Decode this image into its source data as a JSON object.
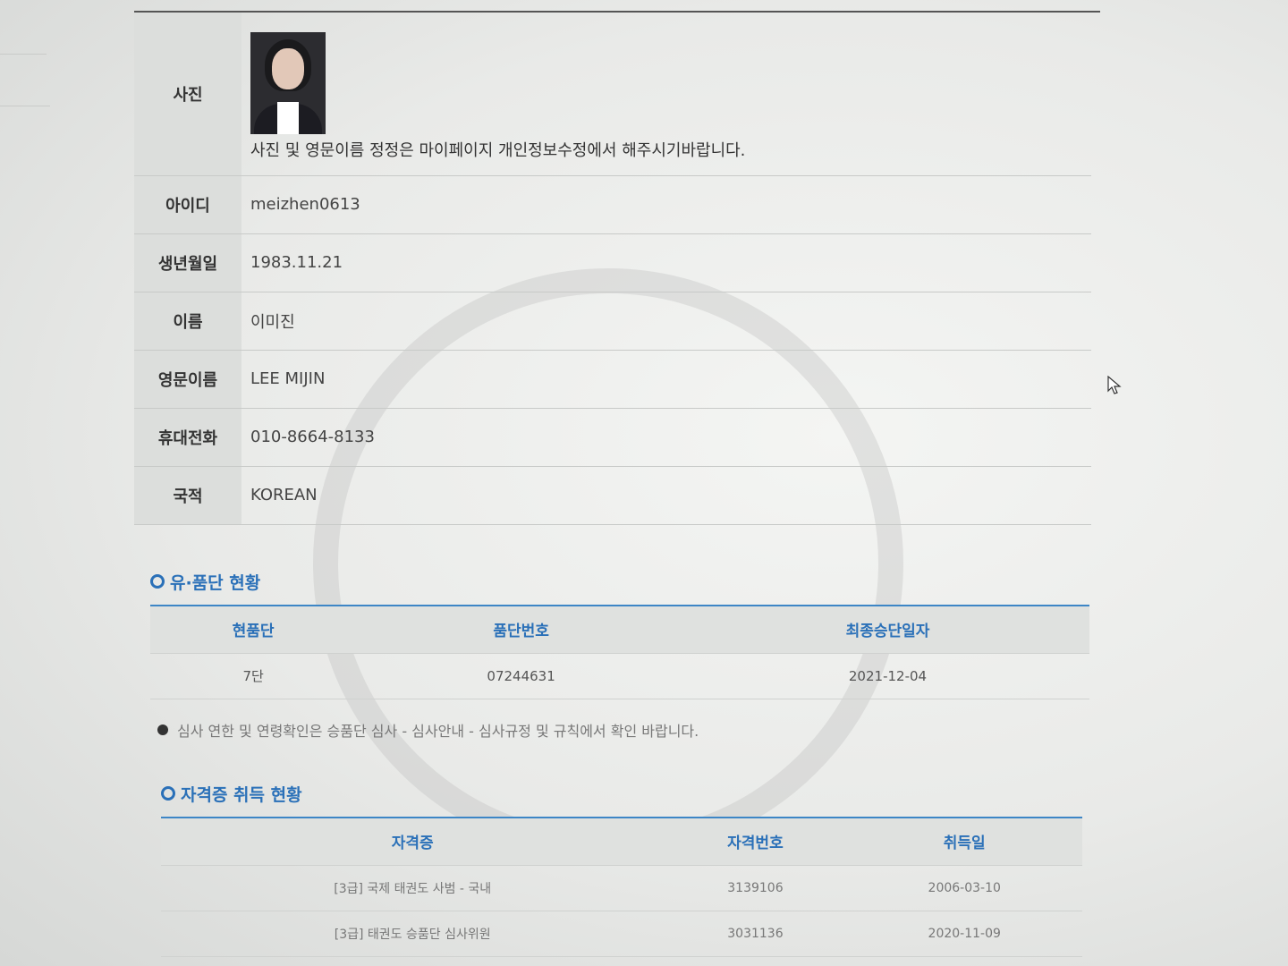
{
  "profile": {
    "photo_label": "사진",
    "photo_note": "사진 및 영문이름 정정은 마이페이지 개인정보수정에서 해주시기바랍니다.",
    "fields": [
      {
        "label": "아이디",
        "value": "meizhen0613"
      },
      {
        "label": "생년월일",
        "value": "1983.11.21"
      },
      {
        "label": "이름",
        "value": "이미진"
      },
      {
        "label": "영문이름",
        "value": "LEE MIJIN"
      },
      {
        "label": "휴대전화",
        "value": "010-8664-8133"
      },
      {
        "label": "국적",
        "value": "KOREAN"
      }
    ]
  },
  "dan_status": {
    "title": "유·품단 현황",
    "headers": [
      "현품단",
      "품단번호",
      "최종승단일자"
    ],
    "rows": [
      [
        "7단",
        "07244631",
        "2021-12-04"
      ]
    ]
  },
  "notice": "심사 연한 및 연령확인은 승품단 심사 - 심사안내 - 심사규정 및 규칙에서 확인 바랍니다.",
  "certificates": {
    "title": "자격증 취득 현황",
    "headers": [
      "자격증",
      "자격번호",
      "취득일"
    ],
    "rows": [
      [
        "[3급] 국제 태권도 사범 - 국내",
        "3139106",
        "2006-03-10"
      ],
      [
        "[3급] 태권도 승품단 심사위원",
        "3031136",
        "2020-11-09"
      ]
    ]
  }
}
